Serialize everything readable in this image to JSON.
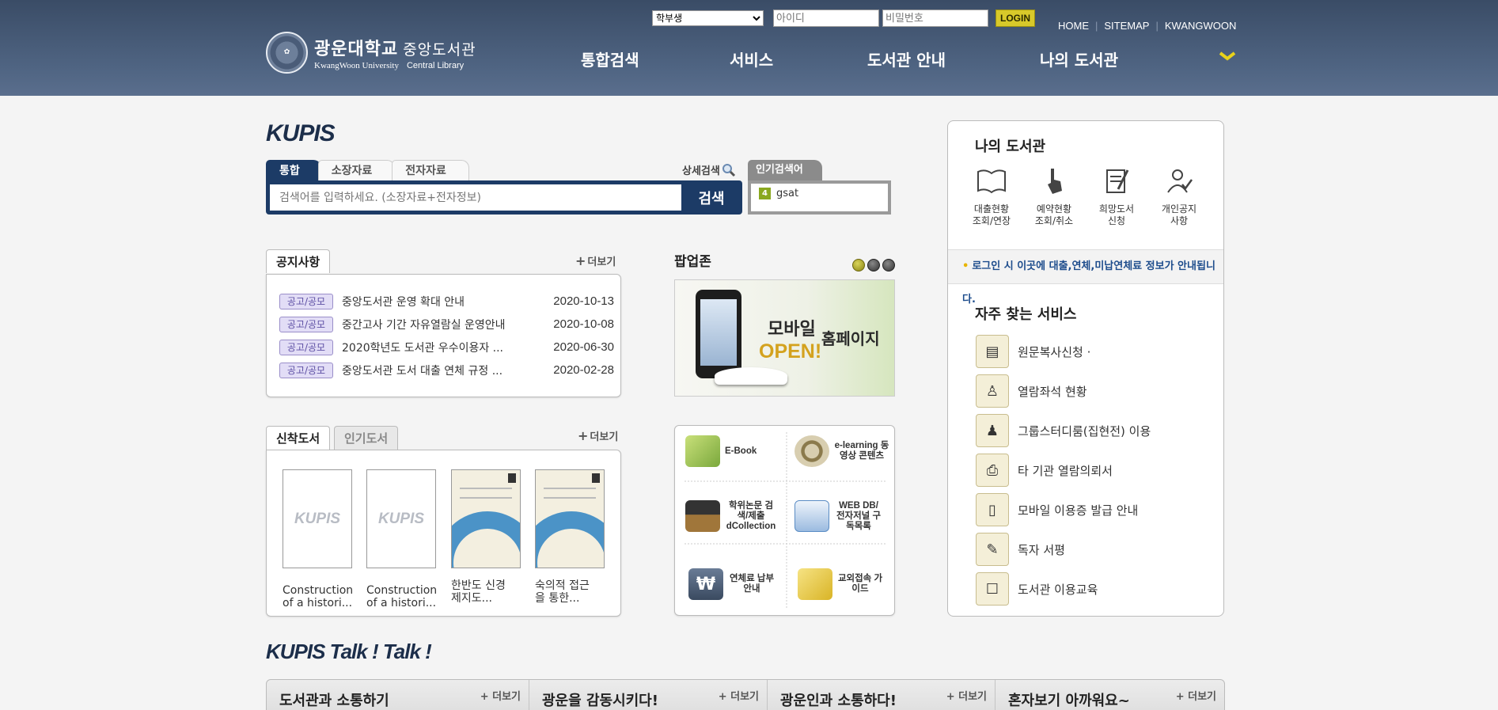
{
  "header": {
    "logo_kor": "광운대학교",
    "logo_kor_sub": "중앙도서관",
    "logo_eng": "KwangWoon University",
    "logo_eng_sub": "Central Library",
    "login": {
      "user_type_selected": "학부생",
      "id_placeholder": "아이디",
      "pw_placeholder": "비밀번호",
      "login_label": "LOGIN"
    },
    "util_links": [
      "HOME",
      "SITEMAP",
      "KWANGWOON"
    ],
    "menu": [
      "통합검색",
      "서비스",
      "도서관 안내",
      "나의 도서관"
    ]
  },
  "search": {
    "title": "KUPIS",
    "tabs": [
      "통합",
      "소장자료",
      "전자자료"
    ],
    "advanced_label": "상세검색",
    "placeholder": "검색어를 입력하세요. (소장자료+전자정보)",
    "button_label": "검색",
    "popular_tab": "인기검색어",
    "popular_items": [
      {
        "rank": "4",
        "term": "gsat"
      }
    ]
  },
  "notice": {
    "tab_label": "공지사항",
    "more_label": "더보기",
    "items": [
      {
        "badge": "공고/공모",
        "title": "중앙도서관 운영 확대 안내",
        "date": "2020-10-13"
      },
      {
        "badge": "공고/공모",
        "title": "중간고사 기간 자유열람실 운영안내",
        "date": "2020-10-08"
      },
      {
        "badge": "공고/공모",
        "title": "2020학년도 도서관 우수이용자 ...",
        "date": "2020-06-30"
      },
      {
        "badge": "공고/공모",
        "title": "중앙도서관 도서 대출 연체 규정 ...",
        "date": "2020-02-28"
      }
    ]
  },
  "popup": {
    "title": "팝업존",
    "banner_text1": "모바일",
    "banner_text2": "홈페이지",
    "banner_text3": "OPEN!"
  },
  "new_books": {
    "tabs": [
      "신착도서",
      "인기도서"
    ],
    "more_label": "더보기",
    "cover_placeholder": "KUPIS",
    "items": [
      {
        "title_line1": "Construction",
        "title_line2": "of a histori..."
      },
      {
        "title_line1": "Construction",
        "title_line2": "of a histori..."
      },
      {
        "title_line1": "한반도 신경",
        "title_line2": "제지도..."
      },
      {
        "title_line1": "숙의적 접근",
        "title_line2": "을 통한..."
      }
    ]
  },
  "services": [
    {
      "label": "E-Book",
      "color": "#7aa83c"
    },
    {
      "label": "e-learning 동영상 콘텐츠",
      "color": "#8b7a4c"
    },
    {
      "label": "학위논문 검색/제출 dCollection",
      "color": "#333333"
    },
    {
      "label": "WEB DB/ 전자저널 구독목록",
      "color": "#5a8cc4"
    },
    {
      "label": "연체료 납부 안내",
      "color": "#3a4a60"
    },
    {
      "label": "교외접속 가이드",
      "color": "#d9b426"
    }
  ],
  "my_library": {
    "title": "나의 도서관",
    "items": [
      {
        "line1": "대출현황",
        "line2": "조회/연장"
      },
      {
        "line1": "예약현황",
        "line2": "조회/취소"
      },
      {
        "line1": "희망도서",
        "line2": "신청"
      },
      {
        "line1": "개인공지",
        "line2": "사항"
      }
    ],
    "notice": "로그인 시 이곳에 대출,연체,미납연체료 정보가 안내됩니다.",
    "freq_title": "자주 찾는 서비스",
    "freq_items": [
      "원문복사신청 ·",
      "열람좌석 현황",
      "그룹스터디룸(집현전) 이용",
      "타 기관 열람의뢰서",
      "모바일 이용증 발급 안내",
      "독자 서평",
      "도서관 이용교육"
    ]
  },
  "talk": {
    "title": "KUPIS Talk ! Talk !",
    "more_label": "더보기",
    "columns": [
      "도서관과 소통하기",
      "광운을 감동시키다!",
      "광운인과 소통하다!",
      "혼자보기 아까워요~"
    ]
  },
  "colors": {
    "header_bg": "#4f6482",
    "search_navy": "#1c3b66",
    "accent_yellow": "#d8c92a",
    "badge_purple": "#e2ddf6"
  }
}
